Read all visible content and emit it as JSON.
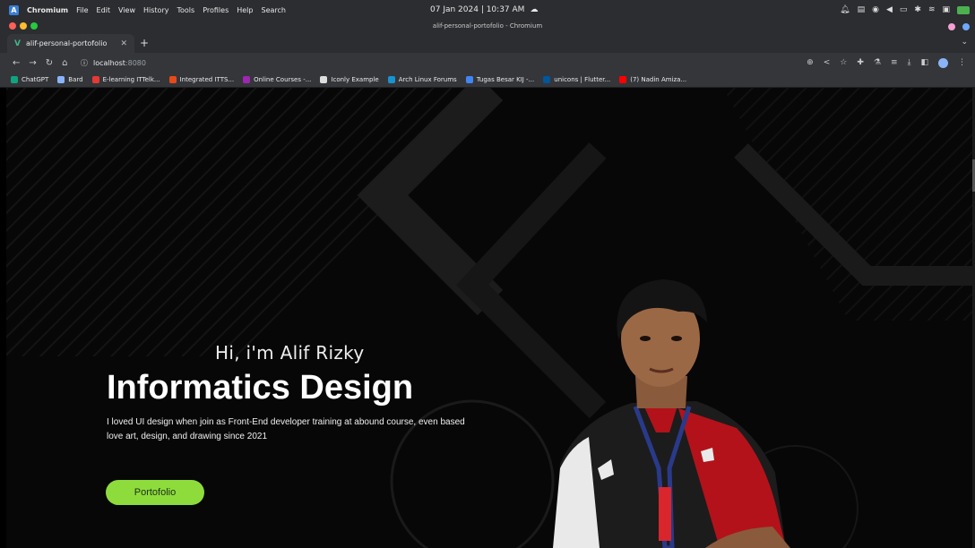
{
  "os": {
    "app_name": "Chromium",
    "menu": [
      "File",
      "Edit",
      "View",
      "History",
      "Tools",
      "Profiles",
      "Help",
      "Search"
    ],
    "clock": "07 Jan 2024 | 10:37 AM"
  },
  "window": {
    "title": "alif-personal-portofolio - Chromium"
  },
  "tabs": [
    {
      "label": "alif-personal-portofolio"
    }
  ],
  "address": {
    "host": "localhost",
    "port": ":8080"
  },
  "bookmarks": [
    {
      "label": "ChatGPT",
      "color": "#10a37f"
    },
    {
      "label": "Bard",
      "color": "#8ab4f8"
    },
    {
      "label": "E-learning ITTelk...",
      "color": "#e53935"
    },
    {
      "label": "Integrated ITTS...",
      "color": "#e64a19"
    },
    {
      "label": "Online Courses -...",
      "color": "#9c27b0"
    },
    {
      "label": "Iconly Example",
      "color": "#dddddd"
    },
    {
      "label": "Arch Linux Forums",
      "color": "#1793d1"
    },
    {
      "label": "Tugas Besar KIJ -...",
      "color": "#4285f4"
    },
    {
      "label": "unicons | Flutter...",
      "color": "#02569b"
    },
    {
      "label": "(7) Nadin Amiza...",
      "color": "#ff0000"
    }
  ],
  "hero": {
    "greeting": "Hi, i'm Alif Rizky",
    "title": "Informatics Design",
    "description": "I loved UI design when join as Front-End developer training at abound course, even based love art, design, and drawing since 2021",
    "cta_label": "Portofolio",
    "cta_color": "#8ddc3c"
  }
}
